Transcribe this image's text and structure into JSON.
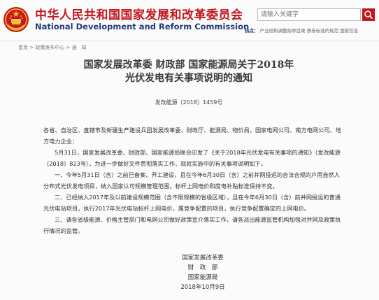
{
  "header": {
    "title_cn": "中华人民共和国国家发展和改革委员会",
    "title_en": "National Development and Reform Commission",
    "search_placeholder": "请输入关键字",
    "hot_prefix": "热点：",
    "hot_items": [
      "产业结构调整指导目录",
      "债券标准的规范",
      "国家信息"
    ]
  },
  "breadcrumb": "首页 > 政策发布中心 > 通　知",
  "document": {
    "title_line1": "国家发展改革委  财政部  国家能源局关于2018年",
    "title_line2": "光伏发电有关事项说明的通知",
    "doc_number": "发改能源〔2018〕1459号",
    "recipients": "各省、自治区、直辖市及新疆生产建设兵团发展改革委、财政厅、能源局、物价局，国家电网公司、南方电网公司、地方电力企业：",
    "para1": "5月31日，国家发展改革委、财政部、国家能源局联合印发了《关于2018年光伏发电有关事项的通知》（发改能源〔2018〕823号），为进一步做好文件贯彻落实工作，现就实施中的有关事项说明如下。",
    "para2": "一、今年5月31日（含）之前已备案、开工建设，且在今年6月30日（含）之前并网投运的合法合规的户用自然人分布式光伏发电项目，纳入国家认可规模管理范围，标杆上网电价和度电补贴标准保持不变。",
    "para3": "二、已经纳入2017年及以前建设规模范围（含不限规模的省级区域），且在今年6月30日（含）前并网投运的普通光伏电站项目，执行2017年光伏电站标杆上网电价，属竞争配置的项目，执行竞争配置确定的上网电价。",
    "para4": "三、请各省级能源、价格主管部门和电网公司做好政策宣介落实工作，请各派出能源监管机构加强对并网及政策执行情况的监管。",
    "signatories": [
      "国家发展改革委",
      "财　政　部",
      "国家能源局"
    ],
    "date": "2018年10月9日"
  }
}
